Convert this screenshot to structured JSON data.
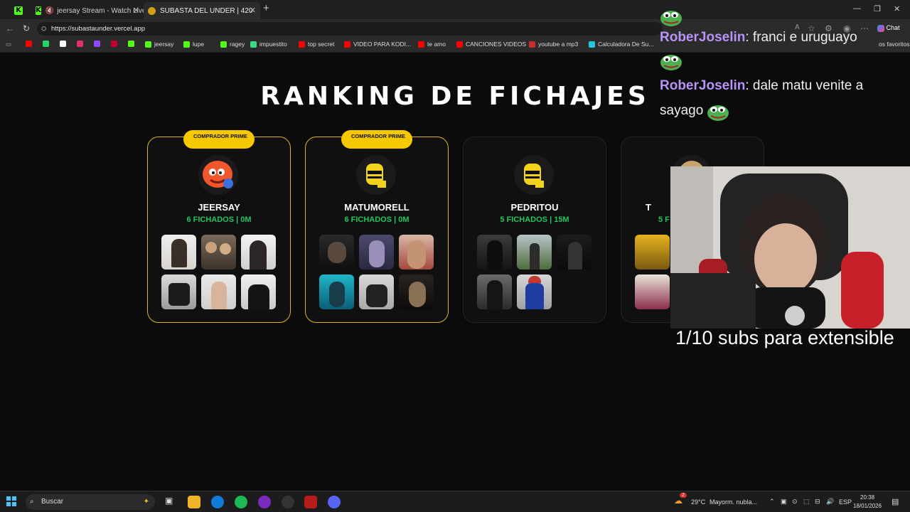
{
  "browser": {
    "tabs": [
      {
        "label": "",
        "icon": "kick-icon"
      },
      {
        "label": "jeersay Stream - Watch Live o",
        "icon": "kick-icon",
        "muted": true
      },
      {
        "label": "SUBASTA DEL UNDER | 420",
        "icon": "site-favicon",
        "active": true
      }
    ],
    "new_tab": "+",
    "url": "https://subastaunder.vercel.app",
    "chat_button": "Chat",
    "bookmarks": [
      {
        "label": "",
        "color": "#ff0000"
      },
      {
        "label": "",
        "color": "#25d366"
      },
      {
        "label": "",
        "color": "#ffffff"
      },
      {
        "label": "",
        "color": "#e1306c"
      },
      {
        "label": "",
        "color": "#9146ff"
      },
      {
        "label": "",
        "color": "#c4002f"
      },
      {
        "label": "",
        "color": "#53fc18"
      },
      {
        "label": "jeersay",
        "color": "#53fc18"
      },
      {
        "label": "lupe",
        "color": "#53fc18"
      },
      {
        "label": "ragey",
        "color": "#53fc18"
      },
      {
        "label": "impuestito",
        "color": "#3ddc84"
      },
      {
        "label": "top secret",
        "color": "#ff0000"
      },
      {
        "label": "VIDEO PARA KODI...",
        "color": "#ff0000"
      },
      {
        "label": "te amo",
        "color": "#ff0000"
      },
      {
        "label": "CANCIONES VIDEOS",
        "color": "#ff0000"
      },
      {
        "label": "youtube a mp3",
        "color": "#c4302b"
      },
      {
        "label": "Calculadora De Su...",
        "color": "#26c6da"
      }
    ],
    "other_bookmarks": "os favoritos"
  },
  "page": {
    "title": "RANKING DE FICHAJES",
    "cards": [
      {
        "name": "JEERSAY",
        "stats": "6 FICHADOS | 0M",
        "badge": "COMPRADOR PRIME",
        "prime": true,
        "avatar": "orange-cartoon-avatar",
        "thumbs": 6
      },
      {
        "name": "MATUMORELL",
        "stats": "6 FICHADOS | 0M",
        "badge": "COMPRADOR PRIME",
        "prime": true,
        "avatar": "yellow-pixel-avatar",
        "thumbs": 6
      },
      {
        "name": "PEDRITOU",
        "stats": "5 FICHADOS | 15M",
        "badge": "",
        "prime": false,
        "avatar": "yellow-pixel-avatar",
        "thumbs": 5
      },
      {
        "name": "T",
        "stats": "5 F",
        "badge": "",
        "prime": false,
        "avatar": "dog-avatar",
        "thumbs": 2
      }
    ]
  },
  "stream_overlay": {
    "chat": [
      {
        "user": "RoberJoselin",
        "text": ": franci e uruguayo"
      },
      {
        "user": "RoberJoselin",
        "text": ": dale matu venite a sayago"
      }
    ],
    "subs_goal": "1/10 subs para extensible"
  },
  "taskbar": {
    "search_placeholder": "Buscar",
    "weather_temp": "29°C",
    "weather_desc": "Mayorm. nubla...",
    "language": "ESP",
    "time": "20:38",
    "date": "18/01/2026",
    "notif_count": "2"
  }
}
